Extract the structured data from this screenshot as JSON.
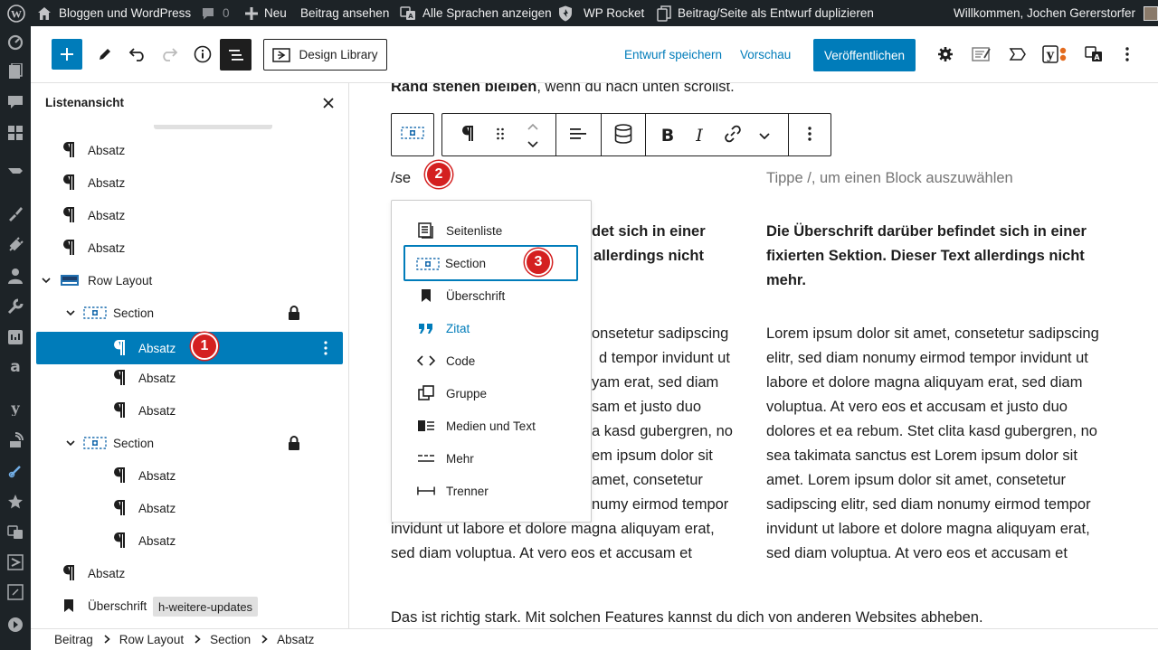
{
  "colors": {
    "accent": "#007cba",
    "admin_bar": "#1d2327",
    "badge": "#d42020"
  },
  "admin_bar": {
    "site_name": "Bloggen und WordPress",
    "comments_count": "0",
    "new_label": "Neu",
    "view_post": "Beitrag ansehen",
    "show_all_languages": "Alle Sprachen anzeigen",
    "wp_rocket": "WP Rocket",
    "duplicate_draft": "Beitrag/Seite als Entwurf duplizieren",
    "greeting": "Willkommen, Jochen Gererstorfer"
  },
  "header": {
    "design_library": "Design Library",
    "save_draft": "Entwurf speichern",
    "preview": "Vorschau",
    "publish": "Veröffentlichen"
  },
  "list_view": {
    "title": "Listenansicht",
    "rows": [
      {
        "label": "Absatz",
        "icon": "paragraph-icon"
      },
      {
        "label": "Absatz",
        "icon": "paragraph-icon"
      },
      {
        "label": "Absatz",
        "icon": "paragraph-icon"
      },
      {
        "label": "Absatz",
        "icon": "paragraph-icon"
      },
      {
        "label": "Row Layout",
        "icon": "row-layout-icon"
      },
      {
        "label": "Section",
        "icon": "section-icon",
        "locked": true
      },
      {
        "label": "Absatz",
        "icon": "paragraph-icon",
        "selected": true,
        "badge": "1"
      },
      {
        "label": "Absatz",
        "icon": "paragraph-icon"
      },
      {
        "label": "Absatz",
        "icon": "paragraph-icon"
      },
      {
        "label": "Section",
        "icon": "section-icon",
        "locked": true
      },
      {
        "label": "Absatz",
        "icon": "paragraph-icon"
      },
      {
        "label": "Absatz",
        "icon": "paragraph-icon"
      },
      {
        "label": "Absatz",
        "icon": "paragraph-icon"
      },
      {
        "label": "Absatz",
        "icon": "paragraph-icon"
      },
      {
        "label": "Überschrift",
        "icon": "heading-icon",
        "tag": "h-weitere-updates"
      }
    ]
  },
  "canvas": {
    "top_line_bold": "Rand stehen bleiben",
    "top_line_rest": ", wenn du nach unten scrollst.",
    "slash_input": "/se",
    "slash_badge": "2",
    "placeholder": "Tippe /, um einen Block auszuwählen",
    "left_col_bold": [
      "det sich in einer",
      "allerdings nicht"
    ],
    "right_col_bold": [
      "Die Überschrift darüber befindet sich in einer",
      "fixierten Sektion. Dieser Text allerdings nicht",
      "mehr."
    ],
    "left_col_lorem": [
      "onsetetur sadipscing",
      "d tempor invidunt ut",
      "yam erat, sed diam",
      "sam et justo duo",
      "a kasd gubergren, no",
      "em ipsum dolor sit",
      "amet, consetetur",
      "numy eirmod tempor",
      "invidunt ut labore et dolore magna aliquyam erat,",
      "sed diam voluptua. At vero eos et accusam et"
    ],
    "right_col_lorem": [
      "Lorem ipsum dolor sit amet, consetetur sadipscing",
      "elitr, sed diam nonumy eirmod tempor invidunt ut",
      "labore et dolore magna aliquyam erat, sed diam",
      "voluptua. At vero eos et accusam et justo duo",
      "dolores et ea rebum. Stet clita kasd gubergren, no",
      "sea takimata sanctus est Lorem ipsum dolor sit",
      "amet. Lorem ipsum dolor sit amet, consetetur",
      "sadipscing elitr, sed diam nonumy eirmod tempor",
      "invidunt ut labore et dolore magna aliquyam erat,",
      "sed diam voluptua. At vero eos et accusam et"
    ],
    "bottom_line": "Das ist richtig stark. Mit solchen Features kannst du dich von anderen Websites abheben."
  },
  "inserter": {
    "items": [
      {
        "label": "Seitenliste",
        "icon": "page-list-icon"
      },
      {
        "label": "Section",
        "icon": "section-icon",
        "highlighted": true,
        "badge": "3"
      },
      {
        "label": "Überschrift",
        "icon": "heading-icon"
      },
      {
        "label": "Zitat",
        "icon": "quote-icon",
        "accent": true
      },
      {
        "label": "Code",
        "icon": "code-icon"
      },
      {
        "label": "Gruppe",
        "icon": "group-icon"
      },
      {
        "label": "Medien und Text",
        "icon": "media-text-icon"
      },
      {
        "label": "Mehr",
        "icon": "more-icon"
      },
      {
        "label": "Trenner",
        "icon": "separator-icon"
      }
    ]
  },
  "breadcrumb": [
    "Beitrag",
    "Row Layout",
    "Section",
    "Absatz"
  ]
}
